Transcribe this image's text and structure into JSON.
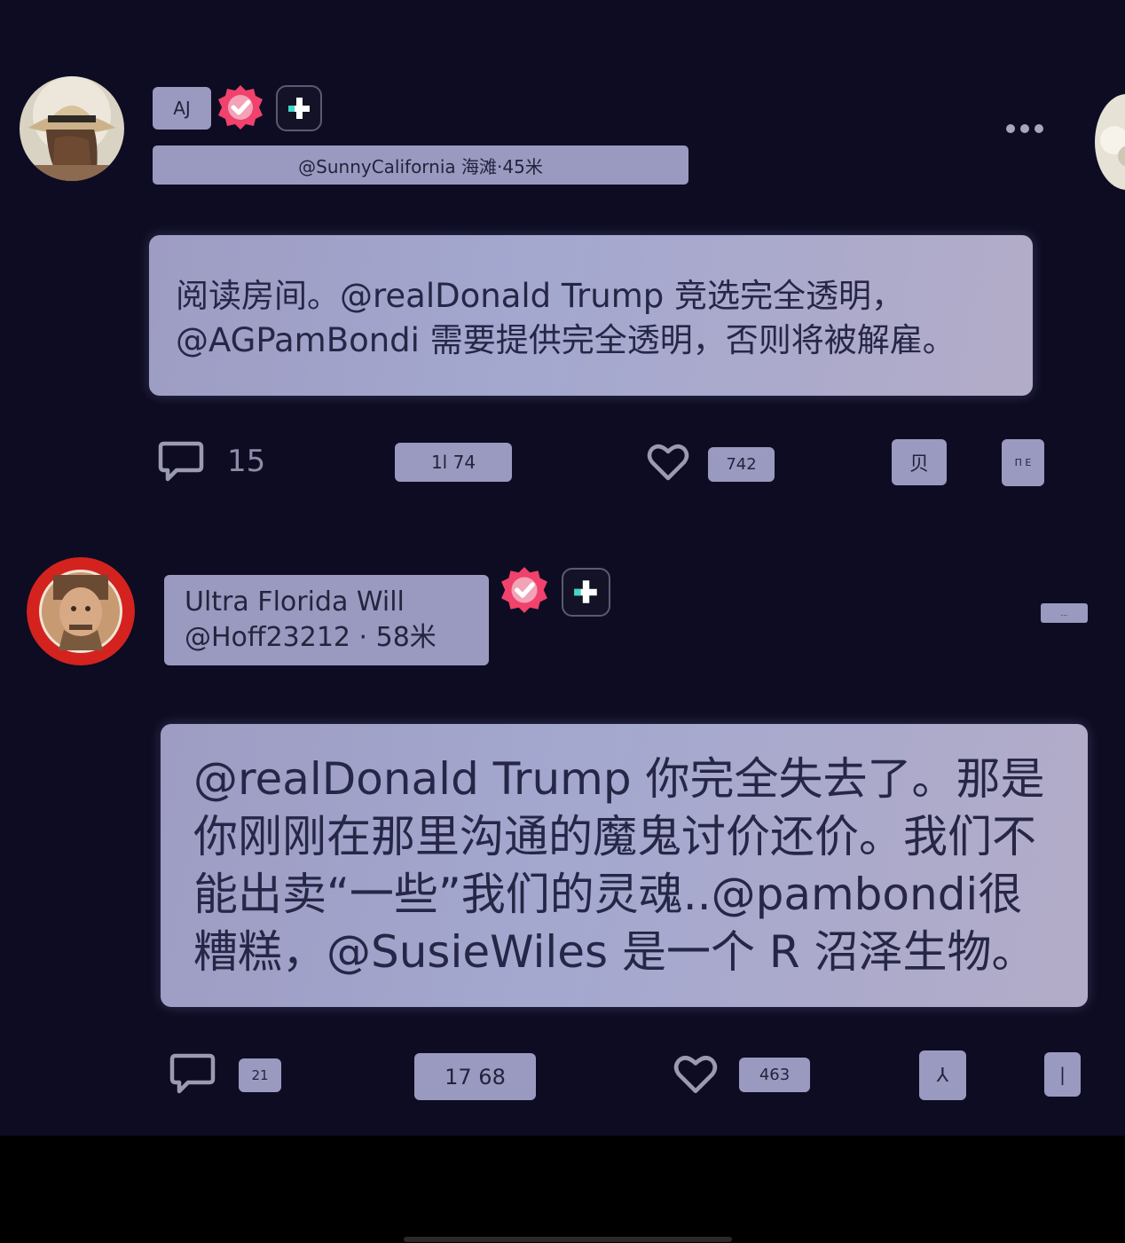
{
  "colors": {
    "background": "#0d0c22",
    "bubble": "#a2a4ca",
    "bubble_text": "#262646",
    "verified_badge": "#f0426c",
    "plus_accent": "#3fd6c8"
  },
  "posts": [
    {
      "author_chip": "AJ",
      "handle_line": "@SunnyCalifornia 海滩·45米",
      "body": "阅读房间。@realDonald Trump 竞选完全透明，@AGPamBondi 需要提供完全透明，否则将被解雇。",
      "reply_count": "15",
      "repost_count": "1l 74",
      "like_count": "742",
      "share_label": "贝",
      "bookmark_label": "Π E",
      "more_icon": "ellipsis-icon",
      "verified_icon": "verified-badge-icon",
      "follow_icon": "plus-icon"
    },
    {
      "display_name": "Ultra Florida Will",
      "handle_line": "@Hoff23212 · 58米",
      "body": "@realDonald Trump 你完全失去了。那是你刚刚在那里沟通的魔鬼讨价还价。我们不能出卖“一些”我们的灵魂..@pambondi很糟糕，@SusieWiles 是一个 R 沼泽生物。",
      "reply_count": "21",
      "repost_count": "17 68",
      "like_count": "463",
      "share_label": "⅄",
      "bookmark_label": "|",
      "more_label": "...",
      "verified_icon": "verified-badge-icon",
      "follow_icon": "plus-icon"
    }
  ]
}
